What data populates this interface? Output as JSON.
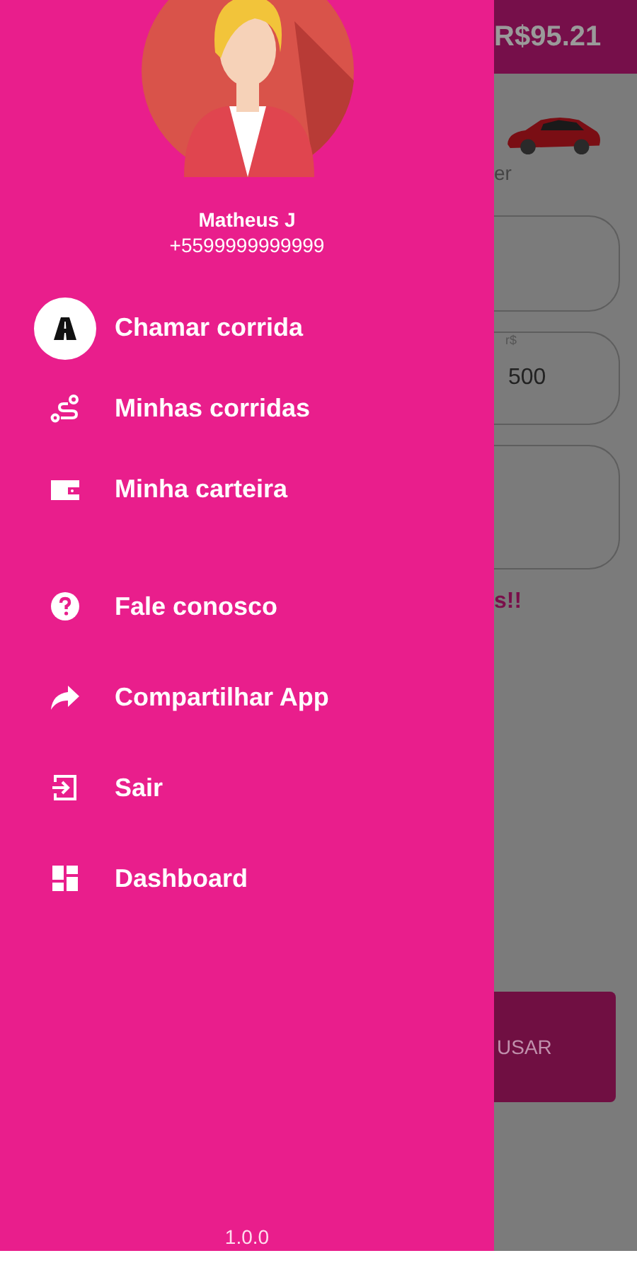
{
  "drawer": {
    "user": {
      "name": "Matheus J",
      "phone": "+5599999999999"
    },
    "sections": [
      {
        "items": [
          {
            "kind": "road",
            "label": "Chamar corrida",
            "selected": true
          },
          {
            "kind": "route",
            "label": "Minhas corridas",
            "selected": false
          },
          {
            "kind": "wallet",
            "label": "Minha carteira",
            "selected": false
          }
        ]
      },
      {
        "items": [
          {
            "kind": "help",
            "label": "Fale conosco",
            "selected": false
          },
          {
            "kind": "share",
            "label": "Compartilhar App",
            "selected": false
          },
          {
            "kind": "exit",
            "label": "Sair",
            "selected": false
          },
          {
            "kind": "dashboard",
            "label": "Dashboard",
            "selected": false
          }
        ]
      }
    ],
    "version": "1.0.0"
  },
  "background": {
    "balance": "R$95.21",
    "car_caption": "er",
    "field_label": "r$",
    "field_value": "500",
    "message": "s!!",
    "button": "USAR"
  }
}
